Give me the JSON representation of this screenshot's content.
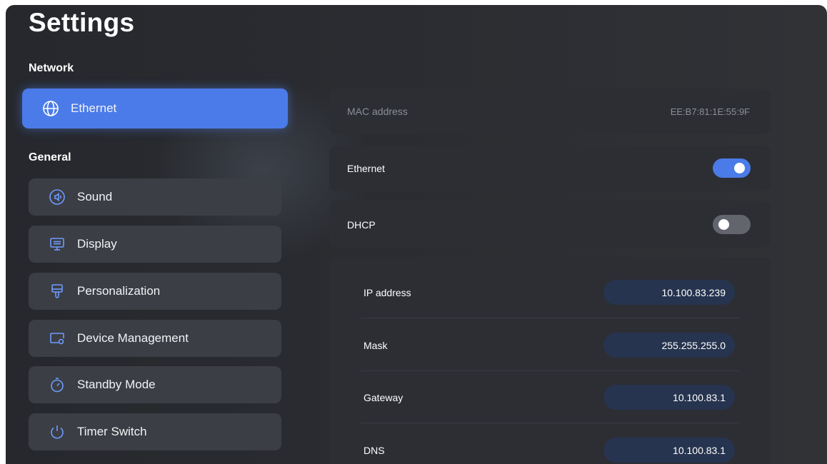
{
  "page": {
    "title": "Settings"
  },
  "sidebar": {
    "network_heading": "Network",
    "network_items": [
      {
        "label": "Ethernet",
        "icon": "globe-icon",
        "active": true
      }
    ],
    "general_heading": "General",
    "general_items": [
      {
        "label": "Sound",
        "icon": "sound-icon"
      },
      {
        "label": "Display",
        "icon": "display-icon"
      },
      {
        "label": "Personalization",
        "icon": "personalization-icon"
      },
      {
        "label": "Device Management",
        "icon": "device-management-icon"
      },
      {
        "label": "Standby Mode",
        "icon": "timer-icon"
      },
      {
        "label": "Timer Switch",
        "icon": "power-icon"
      }
    ]
  },
  "ethernet_panel": {
    "mac": {
      "label": "MAC address",
      "value": "EE:B7:81:1E:55:9F"
    },
    "ethernet_toggle": {
      "label": "Ethernet",
      "on": true
    },
    "dhcp_toggle": {
      "label": "DHCP",
      "on": false
    },
    "fields": [
      {
        "label": "IP address",
        "value": "10.100.83.239"
      },
      {
        "label": "Mask",
        "value": "255.255.255.0"
      },
      {
        "label": "Gateway",
        "value": "10.100.83.1"
      },
      {
        "label": "DNS",
        "value": "10.100.83.1"
      }
    ]
  },
  "colors": {
    "accent": "#4b7be8",
    "background": "#2a2c31",
    "panel": "#2c2e34",
    "nav_item": "#3b3e45",
    "field": "#27344f",
    "toggle_off": "#62656d"
  }
}
